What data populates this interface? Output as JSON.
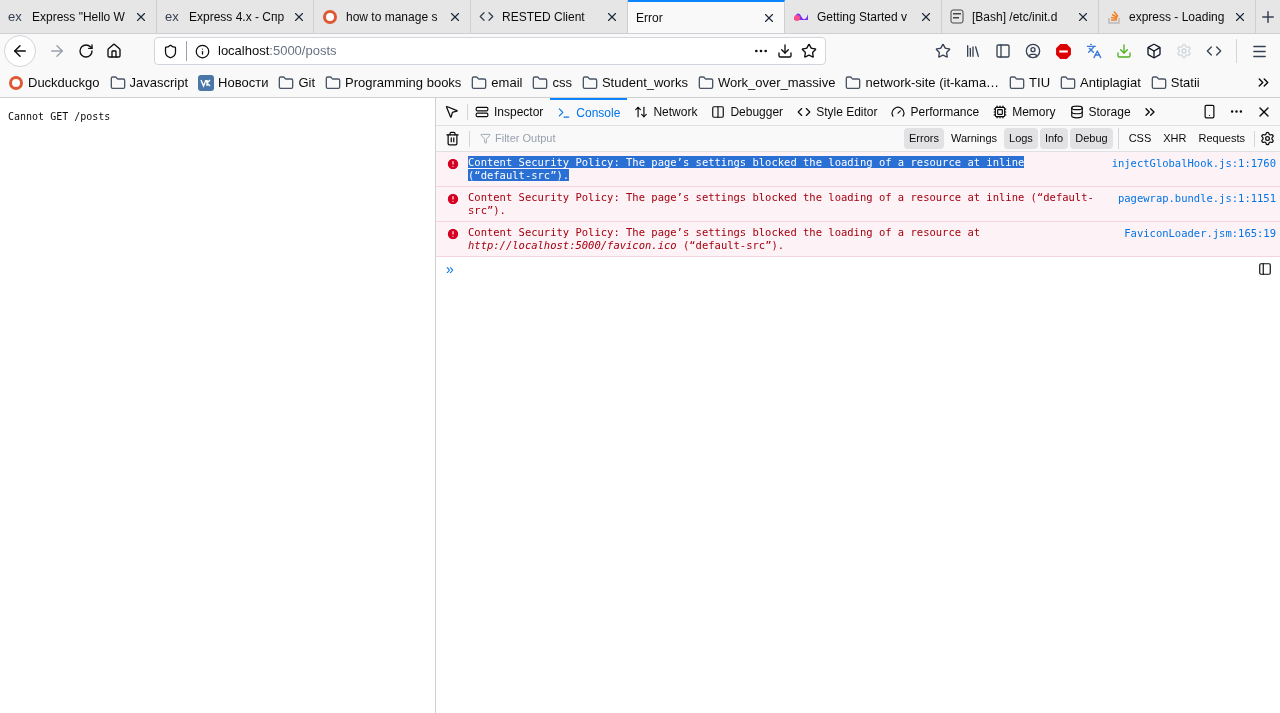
{
  "tabs": [
    {
      "title": "Express \"Hello W",
      "kind": "ex",
      "selected": false
    },
    {
      "title": "Express 4.x - Спр",
      "kind": "ex",
      "selected": false
    },
    {
      "title": "how to manage s",
      "kind": "duck",
      "selected": false
    },
    {
      "title": "RESTED Client",
      "kind": "code",
      "selected": false
    },
    {
      "title": "Error",
      "kind": "plain",
      "selected": true
    },
    {
      "title": "Getting Started v",
      "kind": "wave",
      "selected": false
    },
    {
      "title": "[Bash] /etc/init.d",
      "kind": "doc",
      "selected": false
    },
    {
      "title": "express - Loading",
      "kind": "stack",
      "selected": false
    }
  ],
  "favicon_text": "ex",
  "address": {
    "host": "localhost",
    "rest": ":5000/posts"
  },
  "bookmarks": [
    {
      "label": "Duckduckgo",
      "kind": "duck"
    },
    {
      "label": "Javascript",
      "kind": "folder"
    },
    {
      "label": "Новости",
      "kind": "vk"
    },
    {
      "label": "Git",
      "kind": "folder"
    },
    {
      "label": "Programming books",
      "kind": "folder"
    },
    {
      "label": "email",
      "kind": "folder"
    },
    {
      "label": "css",
      "kind": "folder"
    },
    {
      "label": "Student_works",
      "kind": "folder"
    },
    {
      "label": "Work_over_massive",
      "kind": "folder"
    },
    {
      "label": "network-site (it-kama…",
      "kind": "folder"
    },
    {
      "label": "TIU",
      "kind": "folder"
    },
    {
      "label": "Antiplagiat",
      "kind": "folder"
    },
    {
      "label": "Statii",
      "kind": "folder"
    }
  ],
  "page_text": "Cannot GET /posts",
  "devtools": {
    "tabs": [
      {
        "label": "Inspector",
        "selected": false
      },
      {
        "label": "Console",
        "selected": true
      },
      {
        "label": "Network",
        "selected": false
      },
      {
        "label": "Debugger",
        "selected": false
      },
      {
        "label": "Style Editor",
        "selected": false
      },
      {
        "label": "Performance",
        "selected": false
      },
      {
        "label": "Memory",
        "selected": false
      },
      {
        "label": "Storage",
        "selected": false
      }
    ],
    "filter_placeholder": "Filter Output",
    "levels": [
      {
        "label": "Errors",
        "selected": true
      },
      {
        "label": "Warnings",
        "selected": false
      },
      {
        "label": "Logs",
        "selected": true
      },
      {
        "label": "Info",
        "selected": true
      },
      {
        "label": "Debug",
        "selected": true
      }
    ],
    "types": [
      {
        "label": "CSS",
        "selected": false
      },
      {
        "label": "XHR",
        "selected": false
      },
      {
        "label": "Requests",
        "selected": false
      }
    ],
    "messages": [
      {
        "text": "Content Security Policy: The page’s settings blocked the loading of a resource at inline (“default-src”).",
        "source": "injectGlobalHook.js:1:1760",
        "selected": true
      },
      {
        "text": "Content Security Policy: The page’s settings blocked the loading of a resource at inline (“default-src”).",
        "source": "pagewrap.bundle.js:1:1151",
        "selected": false
      },
      {
        "text": "Content Security Policy: The page’s settings blocked the loading of a resource at *http://localhost:5000/favicon.ico* (“default-src”).",
        "source": "FaviconLoader.jsm:165:19",
        "selected": false
      }
    ],
    "prompt": "»"
  }
}
